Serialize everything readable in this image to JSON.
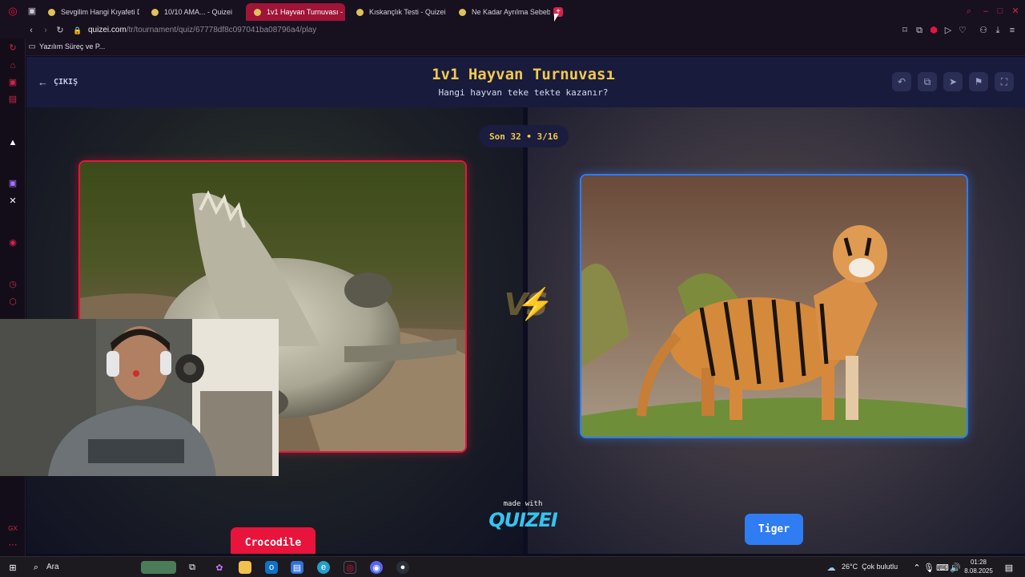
{
  "browser": {
    "tabs": [
      {
        "label": "Sevgilim Hangi Kıyafeti De"
      },
      {
        "label": "10/10 AMA... - Quizei"
      },
      {
        "label": "1v1 Hayvan Turnuvası - Q"
      },
      {
        "label": "Kıskançlık Testi - Quizei"
      },
      {
        "label": "Ne Kadar Ayrılma Sebebi"
      }
    ],
    "url_host": "quizei.com",
    "url_path": "/tr/tournament/quiz/67778df8c097041ba08796a4/play",
    "bookmark": "Yazılım Süreç ve P..."
  },
  "header": {
    "exit_label": "ÇIKIŞ",
    "title": "1v1 Hayvan Turnuvası",
    "subtitle": "Hangi hayvan teke tekte kazanır?"
  },
  "round": {
    "badge": "Son 32 • 3/16"
  },
  "vs_label": "VS",
  "left_choice": {
    "name": "Crocodile"
  },
  "right_choice": {
    "name": "Tiger"
  },
  "branding": {
    "made_with": "made with",
    "logo": "QUIZEI"
  },
  "taskbar": {
    "search": "Ara",
    "weather": "26°C  Çok bulutlu",
    "time": "01:28",
    "date": "8.08.2025"
  },
  "colors": {
    "accent_red": "#e8143c",
    "accent_blue": "#2f7cf3",
    "title_yellow": "#f2c94c",
    "logo_cyan": "#35c4ee"
  }
}
